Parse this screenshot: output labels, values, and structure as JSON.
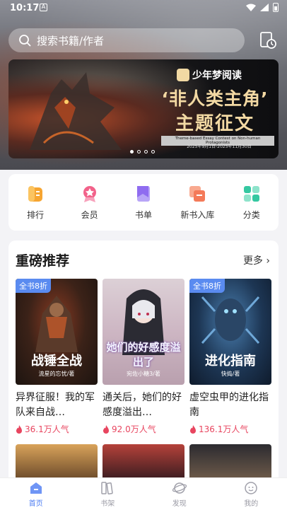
{
  "status_bar": {
    "time": "10:17",
    "notification_letter": "A"
  },
  "search": {
    "placeholder": "搜索书籍/作者",
    "search_icon": "search-icon",
    "history_icon": "reading-history-icon"
  },
  "banner": {
    "brand": "少年梦阅读",
    "title_line1": "‘非人类主角’",
    "title_line2": "主题征文",
    "subtitle_en": "Theme-based Essay Contest on Non-human Protagonists",
    "date_range": "2025年9月1日-2025年11月30日",
    "pages": 4,
    "active_page": 1
  },
  "categories": [
    {
      "label": "排行",
      "icon": "ranking-icon",
      "color": "#f6a531"
    },
    {
      "label": "会员",
      "icon": "vip-icon",
      "color": "#f2628a"
    },
    {
      "label": "书单",
      "icon": "booklist-icon",
      "color": "#8f6cf0"
    },
    {
      "label": "新书入库",
      "icon": "new-books-icon",
      "color": "#f47a59"
    },
    {
      "label": "分类",
      "icon": "category-icon",
      "color": "#35c8a1"
    }
  ],
  "recommend": {
    "title": "重磅推荐",
    "more_label": "更多",
    "books": [
      {
        "tag": "全书8折",
        "cover_title": "战锤全战",
        "cover_author": "流星的忘忧/著",
        "name": "异界征服！我的军队来自战…",
        "hot": "36.1万人气"
      },
      {
        "tag": "",
        "cover_title": "她们的好感度溢出了",
        "cover_author": "宛佐小糖3/著",
        "name": "通关后，她们的好感度溢出…",
        "hot": "92.0万人气"
      },
      {
        "tag": "全书8折",
        "cover_title": "进化指南",
        "cover_author": "快捣/著",
        "name": "虚空虫甲的进化指南",
        "hot": "136.1万人气"
      }
    ]
  },
  "tabbar": [
    {
      "label": "首页",
      "icon": "home-icon",
      "active": true
    },
    {
      "label": "书架",
      "icon": "bookshelf-icon",
      "active": false
    },
    {
      "label": "发现",
      "icon": "discover-icon",
      "active": false
    },
    {
      "label": "我的",
      "icon": "profile-icon",
      "active": false
    }
  ],
  "colors": {
    "accent": "#4e7df2",
    "hot": "#e8455f",
    "tag": "#5a8bf0"
  }
}
